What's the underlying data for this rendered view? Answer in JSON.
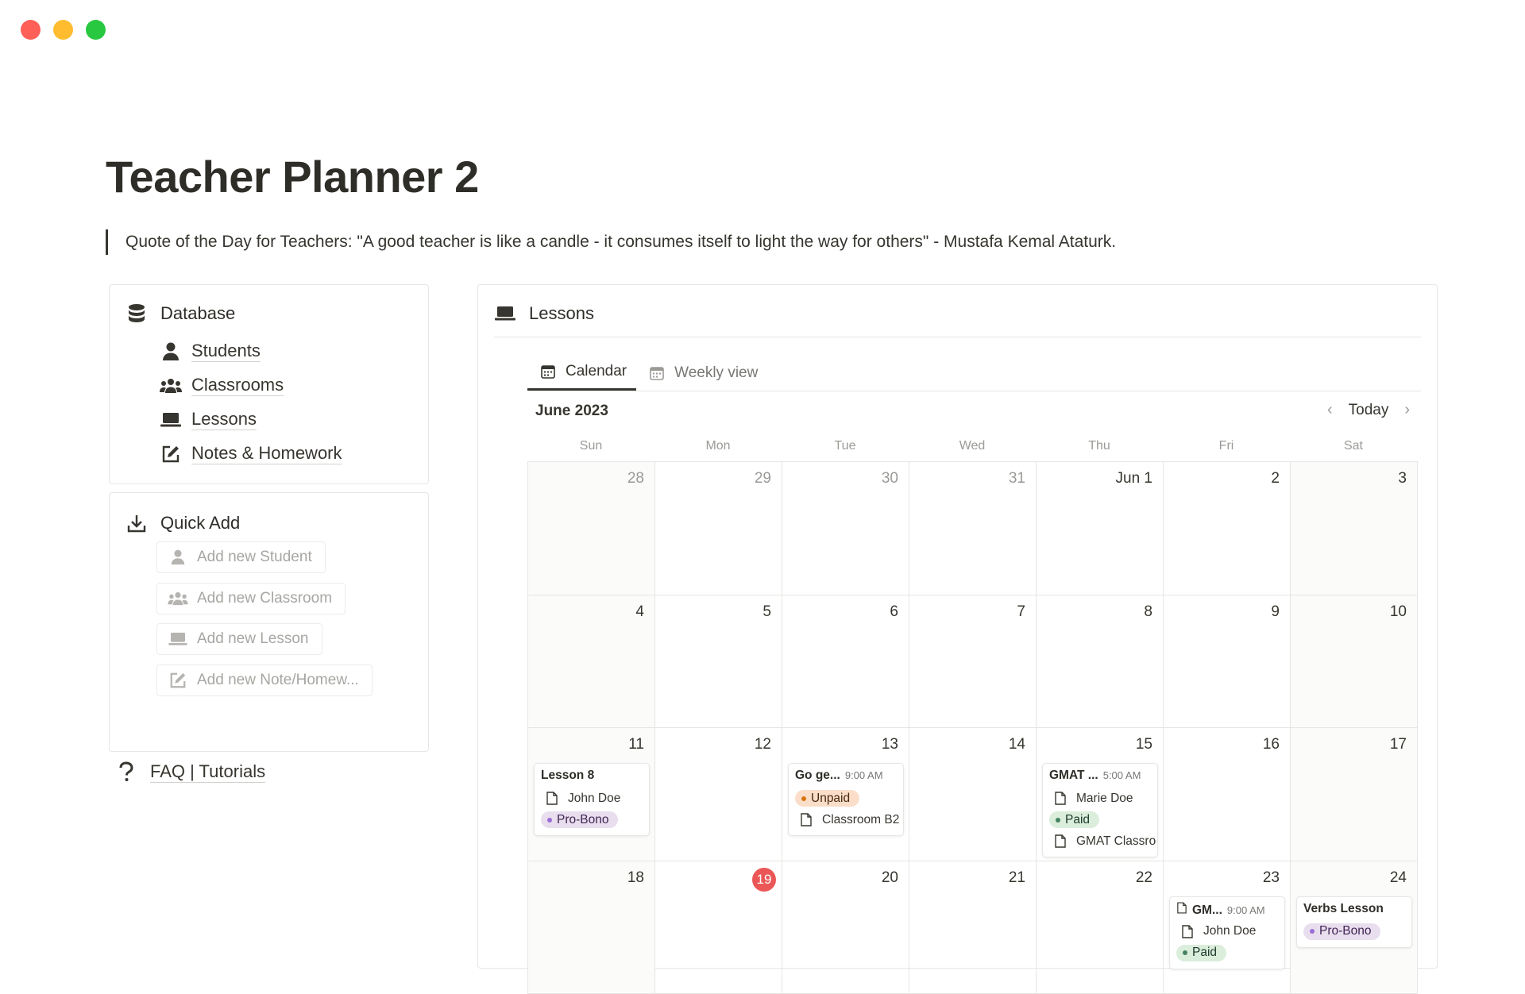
{
  "page": {
    "title": "Teacher Planner 2",
    "quote": "Quote of the Day for Teachers: \"A good teacher is like a candle - it consumes itself to light the way for others\" - Mustafa Kemal Ataturk."
  },
  "database": {
    "heading": "Database",
    "items": [
      {
        "label": "Students",
        "icon": "person-icon"
      },
      {
        "label": "Classrooms",
        "icon": "group-icon"
      },
      {
        "label": "Lessons",
        "icon": "laptop-icon"
      },
      {
        "label": "Notes & Homework",
        "icon": "edit-icon"
      }
    ]
  },
  "quick_add": {
    "heading": "Quick Add",
    "buttons": [
      {
        "label": "Add new Student",
        "icon": "person-icon"
      },
      {
        "label": "Add new Classroom",
        "icon": "group-icon"
      },
      {
        "label": "Add new Lesson",
        "icon": "laptop-icon"
      },
      {
        "label": "Add new Note/Homew...",
        "icon": "edit-icon"
      }
    ]
  },
  "faq": {
    "label": "FAQ | Tutorials"
  },
  "lessons": {
    "heading": "Lessons",
    "tabs": [
      {
        "label": "Calendar",
        "active": true
      },
      {
        "label": "Weekly view",
        "active": false
      }
    ],
    "month": "June 2023",
    "today_label": "Today",
    "weekdays": [
      "Sun",
      "Mon",
      "Tue",
      "Wed",
      "Thu",
      "Fri",
      "Sat"
    ],
    "weeks": [
      [
        "28",
        "29",
        "30",
        "31",
        "Jun 1",
        "2",
        "3"
      ],
      [
        "4",
        "5",
        "6",
        "7",
        "8",
        "9",
        "10"
      ],
      [
        "11",
        "12",
        "13",
        "14",
        "15",
        "16",
        "17"
      ],
      [
        "18",
        "19",
        "20",
        "21",
        "22",
        "23",
        "24"
      ]
    ],
    "events": {
      "e1": {
        "title": "Lesson 8",
        "student": "John Doe",
        "status": "Pro-Bono"
      },
      "e2": {
        "title": "Go ge...",
        "time": "9:00 AM",
        "status": "Unpaid",
        "classroom": "Classroom B2"
      },
      "e3": {
        "title": "GMAT ...",
        "time": "5:00 AM",
        "student": "Marie Doe",
        "status": "Paid",
        "classroom": "GMAT Classro"
      },
      "e4": {
        "title": "GM...",
        "time": "9:00 AM",
        "student": "John Doe",
        "status": "Paid"
      },
      "e5": {
        "title": "Verbs Lesson",
        "status": "Pro-Bono"
      }
    }
  },
  "colors": {
    "today": "#eb5757",
    "tag_purple": "#e8deee",
    "tag_orange": "#fadec9",
    "tag_green": "#dbeddb"
  }
}
